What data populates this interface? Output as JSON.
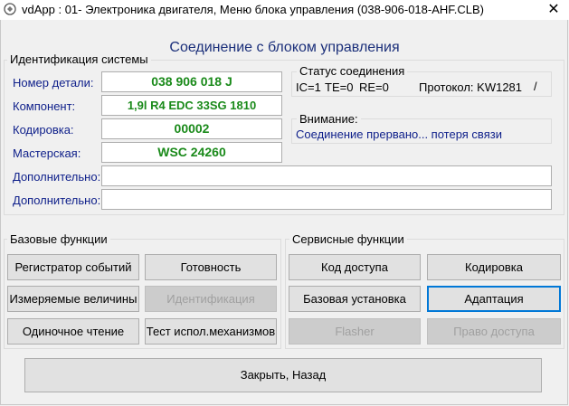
{
  "window": {
    "title": "vdApp : 01- Электроника двигателя,  Меню блока управления (038-906-018-AHF.CLB)",
    "close_glyph": "✕"
  },
  "header": {
    "title": "Соединение с блоком управления"
  },
  "identification": {
    "group_label": "Идентификация системы",
    "fields": [
      {
        "label": "Номер детали:",
        "value": "038 906 018 J"
      },
      {
        "label": "Компонент:",
        "value": "1,9l R4 EDC   33SG  1810"
      },
      {
        "label": "Кодировка:",
        "value": "00002"
      },
      {
        "label": "Мастерская:",
        "value": "WSC 24260"
      },
      {
        "label": "Дополнительно:",
        "value": ""
      },
      {
        "label": "Дополнительно:",
        "value": ""
      }
    ]
  },
  "connection_status": {
    "group_label": "Статус соединения",
    "ic": "IC=1",
    "te": "TE=0",
    "re": "RE=0",
    "protocol": "Протокол: KW1281",
    "slash": "/"
  },
  "warning": {
    "group_label": "Внимание:",
    "message": "Соединение прервано... потеря связи"
  },
  "basic_functions": {
    "group_label": "Базовые функции",
    "buttons": [
      {
        "label": "Регистратор событий",
        "enabled": true
      },
      {
        "label": "Готовность",
        "enabled": true
      },
      {
        "label": "Измеряемые величины",
        "enabled": true
      },
      {
        "label": "Идентификация",
        "enabled": false
      },
      {
        "label": "Одиночное чтение",
        "enabled": true
      },
      {
        "label": "Тест испол.механизмов",
        "enabled": true
      }
    ]
  },
  "service_functions": {
    "group_label": "Сервисные функции",
    "buttons": [
      {
        "label": "Код доступа",
        "enabled": true
      },
      {
        "label": "Кодировка",
        "enabled": true
      },
      {
        "label": "Базовая установка",
        "enabled": true
      },
      {
        "label": "Адаптация",
        "enabled": true,
        "focused": true
      },
      {
        "label": "Flasher",
        "enabled": false
      },
      {
        "label": "Право доступа",
        "enabled": false
      }
    ]
  },
  "footer": {
    "close_label": "Закрыть, Назад"
  },
  "colors": {
    "value_green": "#1a8a1a",
    "label_blue": "#10218b",
    "title_blue": "#1b2f7a",
    "focus_blue": "#0078d7"
  }
}
